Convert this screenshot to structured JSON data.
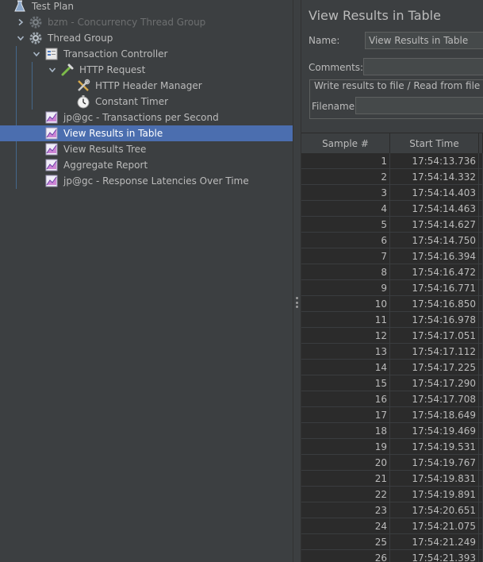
{
  "tree": [
    {
      "label": "Test Plan",
      "depth": 0,
      "chevron": "",
      "icon": "flask",
      "state": "normal"
    },
    {
      "label": "bzm - Concurrency Thread Group",
      "depth": 1,
      "chevron": "right",
      "icon": "gear",
      "state": "disabled"
    },
    {
      "label": "Thread Group",
      "depth": 1,
      "chevron": "down",
      "icon": "gear",
      "state": "normal"
    },
    {
      "label": "Transaction Controller",
      "depth": 2,
      "chevron": "down",
      "icon": "controller",
      "state": "normal"
    },
    {
      "label": "HTTP Request",
      "depth": 3,
      "chevron": "down",
      "icon": "pipette",
      "state": "normal"
    },
    {
      "label": "HTTP Header Manager",
      "depth": 4,
      "chevron": "",
      "icon": "tools",
      "state": "normal"
    },
    {
      "label": "Constant Timer",
      "depth": 4,
      "chevron": "",
      "icon": "timer",
      "state": "normal"
    },
    {
      "label": "jp@gc - Transactions per Second",
      "depth": 2,
      "chevron": "",
      "icon": "graph",
      "state": "normal"
    },
    {
      "label": "View Results in Table",
      "depth": 2,
      "chevron": "",
      "icon": "graph",
      "state": "selected"
    },
    {
      "label": "View Results Tree",
      "depth": 2,
      "chevron": "",
      "icon": "graph",
      "state": "normal"
    },
    {
      "label": "Aggregate Report",
      "depth": 2,
      "chevron": "",
      "icon": "graph",
      "state": "normal"
    },
    {
      "label": "jp@gc - Response Latencies Over Time",
      "depth": 2,
      "chevron": "",
      "icon": "graph",
      "state": "normal"
    }
  ],
  "panel": {
    "title": "View Results in Table",
    "name_label": "Name:",
    "name_value": "View Results in Table",
    "comments_label": "Comments:",
    "comments_value": "",
    "write_group_label": "Write results to file / Read from file",
    "filename_label": "Filename",
    "filename_value": ""
  },
  "table": {
    "headers": [
      "Sample #",
      "Start Time"
    ],
    "rows": [
      [
        "1",
        "17:54:13.736"
      ],
      [
        "2",
        "17:54:14.332"
      ],
      [
        "3",
        "17:54:14.403"
      ],
      [
        "4",
        "17:54:14.463"
      ],
      [
        "5",
        "17:54:14.627"
      ],
      [
        "6",
        "17:54:14.750"
      ],
      [
        "7",
        "17:54:16.394"
      ],
      [
        "8",
        "17:54:16.472"
      ],
      [
        "9",
        "17:54:16.771"
      ],
      [
        "10",
        "17:54:16.850"
      ],
      [
        "11",
        "17:54:16.978"
      ],
      [
        "12",
        "17:54:17.051"
      ],
      [
        "13",
        "17:54:17.112"
      ],
      [
        "14",
        "17:54:17.225"
      ],
      [
        "15",
        "17:54:17.290"
      ],
      [
        "16",
        "17:54:17.708"
      ],
      [
        "17",
        "17:54:18.649"
      ],
      [
        "18",
        "17:54:19.469"
      ],
      [
        "19",
        "17:54:19.531"
      ],
      [
        "20",
        "17:54:19.767"
      ],
      [
        "21",
        "17:54:19.831"
      ],
      [
        "22",
        "17:54:19.891"
      ],
      [
        "23",
        "17:54:20.651"
      ],
      [
        "24",
        "17:54:21.075"
      ],
      [
        "25",
        "17:54:21.249"
      ],
      [
        "26",
        "17:54:21.393"
      ]
    ]
  },
  "colors": {
    "selection": "#4b6eaf",
    "background": "#3c3f41",
    "table_bg": "#2b2b2b",
    "text": "#bbbbbb"
  }
}
